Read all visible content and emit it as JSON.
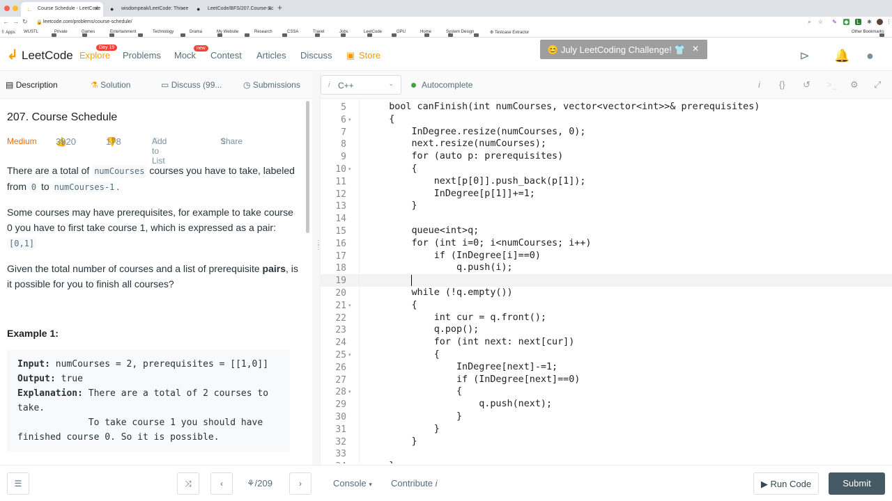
{
  "browser": {
    "tabs": [
      {
        "title": "Course Schedule - LeetCode",
        "icon": "leetcode-icon",
        "active": true
      },
      {
        "title": "wisdompeak/LeetCode: This re",
        "icon": "github-icon",
        "active": false
      },
      {
        "title": "LeetCode/BFS/207.Course-Sc",
        "icon": "github-icon",
        "active": false
      }
    ],
    "url": "leetcode.com/problems/course-schedule/",
    "bookmarks": [
      "Apps",
      "WUSTL",
      "Private",
      "Games",
      "Entertainment",
      "Technology",
      "Drama",
      "My Website",
      "Research",
      "CSSA",
      "Travel",
      "Jobs",
      "LeetCode",
      "GPU",
      "Home",
      "System Design",
      "Testcase Extractor"
    ],
    "other_bookmarks": "Other Bookmarks"
  },
  "nav": {
    "logo": "LeetCode",
    "links": [
      "Explore",
      "Problems",
      "Mock",
      "Contest",
      "Articles",
      "Discuss",
      "Store"
    ],
    "explore_badge": "Day 19",
    "mock_badge": "new",
    "challenge": "July LeetCoding Challenge! 👕",
    "challenge_emoji": "😊"
  },
  "left_tabs": {
    "description": "Description",
    "solution": "Solution",
    "discuss": "Discuss (99...",
    "submissions": "Submissions"
  },
  "problem": {
    "title": "207. Course Schedule",
    "difficulty": "Medium",
    "likes": "3920",
    "dislikes": "178",
    "add_to_list": "Add to List",
    "share": "Share",
    "p1_a": "There are a total of ",
    "p1_code1": "numCourses",
    "p1_b": " courses you have to take, labeled from ",
    "p1_code2": "0",
    "p1_c": " to ",
    "p1_code3": "numCourses-1",
    "p1_d": ".",
    "p2": "Some courses may have prerequisites, for example to take course 0 you have to first take course 1, which is expressed as a pair:",
    "p2_code": "[0,1]",
    "p3_a": "Given the total number of courses and a list of prerequisite ",
    "p3_bold": "pairs",
    "p3_b": ", is it possible for you to finish all courses?",
    "example_title": "Example 1:",
    "ex_input_label": "Input:",
    "ex_input": " numCourses = 2, prerequisites = [[1,0]]",
    "ex_output_label": "Output:",
    "ex_output": " true",
    "ex_expl_label": "Explanation:",
    "ex_expl": " There are a total of 2 courses to take.",
    "ex_expl2": "             To take course 1 you should have finished course 0. So it is possible."
  },
  "editor": {
    "language": "C++",
    "autocomplete": "Autocomplete",
    "lines": [
      {
        "n": "5",
        "code": "    bool canFinish(int numCourses, vector<vector<int>>& prerequisites)",
        "fold": false
      },
      {
        "n": "6",
        "code": "    {",
        "fold": true
      },
      {
        "n": "7",
        "code": "        InDegree.resize(numCourses, 0);",
        "fold": false
      },
      {
        "n": "8",
        "code": "        next.resize(numCourses);",
        "fold": false
      },
      {
        "n": "9",
        "code": "        for (auto p: prerequisites)",
        "fold": false
      },
      {
        "n": "10",
        "code": "        {",
        "fold": true
      },
      {
        "n": "11",
        "code": "            next[p[0]].push_back(p[1]);",
        "fold": false
      },
      {
        "n": "12",
        "code": "            InDegree[p[1]]+=1;",
        "fold": false
      },
      {
        "n": "13",
        "code": "        }",
        "fold": false
      },
      {
        "n": "14",
        "code": "",
        "fold": false
      },
      {
        "n": "15",
        "code": "        queue<int>q;",
        "fold": false
      },
      {
        "n": "16",
        "code": "        for (int i=0; i<numCourses; i++)",
        "fold": false
      },
      {
        "n": "17",
        "code": "            if (InDegree[i]==0)",
        "fold": false
      },
      {
        "n": "18",
        "code": "                q.push(i);",
        "fold": false
      },
      {
        "n": "19",
        "code": "",
        "fold": false
      },
      {
        "n": "20",
        "code": "        while (!q.empty())",
        "fold": false
      },
      {
        "n": "21",
        "code": "        {",
        "fold": true
      },
      {
        "n": "22",
        "code": "            int cur = q.front();",
        "fold": false
      },
      {
        "n": "23",
        "code": "            q.pop();",
        "fold": false
      },
      {
        "n": "24",
        "code": "            for (int next: next[cur])",
        "fold": false
      },
      {
        "n": "25",
        "code": "            {",
        "fold": true
      },
      {
        "n": "26",
        "code": "                InDegree[next]-=1;",
        "fold": false
      },
      {
        "n": "27",
        "code": "                if (InDegree[next]==0)",
        "fold": false
      },
      {
        "n": "28",
        "code": "                {",
        "fold": true
      },
      {
        "n": "29",
        "code": "                    q.push(next);",
        "fold": false
      },
      {
        "n": "30",
        "code": "                }",
        "fold": false
      },
      {
        "n": "31",
        "code": "            }",
        "fold": false
      },
      {
        "n": "32",
        "code": "        }",
        "fold": false
      },
      {
        "n": "33",
        "code": "",
        "fold": false
      },
      {
        "n": "34",
        "code": "    }",
        "fold": false
      }
    ],
    "current_line": "19"
  },
  "bottom": {
    "pager": "⚘/209",
    "console": "Console",
    "contribute": "Contribute",
    "run_code": "Run Code",
    "submit": "Submit"
  },
  "colors": {
    "accent": "#ffa116",
    "submit_bg": "#455a64",
    "medium": "#ef6c00"
  }
}
